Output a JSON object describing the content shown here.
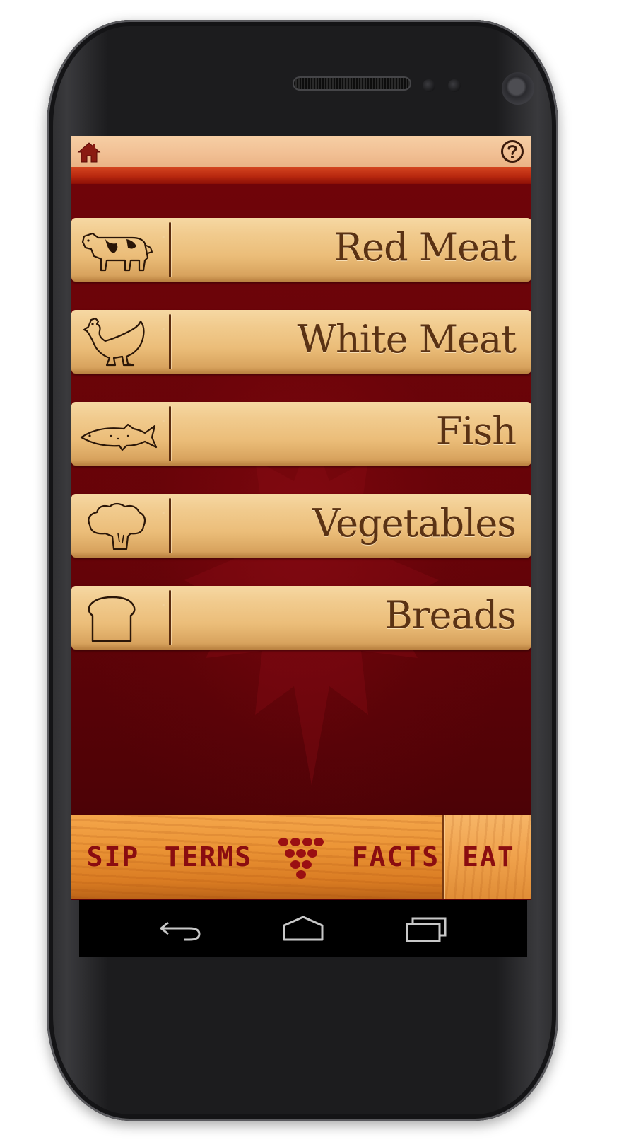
{
  "app": {
    "accent_color": "#8a0d10",
    "background_color": "#5a0208"
  },
  "header": {
    "home_icon": "home-icon",
    "help_icon": "help-icon"
  },
  "menu": {
    "items": [
      {
        "label": "Red Meat",
        "icon": "cow-icon"
      },
      {
        "label": "White Meat",
        "icon": "chicken-icon"
      },
      {
        "label": "Fish",
        "icon": "fish-icon"
      },
      {
        "label": "Vegetables",
        "icon": "broccoli-icon"
      },
      {
        "label": "Breads",
        "icon": "bread-icon"
      }
    ]
  },
  "tabs": {
    "sip": "SIP",
    "terms": "TERMS",
    "grapes_icon": "grapes-icon",
    "facts": "FACTS",
    "eat": "EAT",
    "selected": "EAT"
  },
  "system_nav": {
    "back_icon": "back-icon",
    "home_icon": "home-outline-icon",
    "recents_icon": "recents-icon"
  }
}
